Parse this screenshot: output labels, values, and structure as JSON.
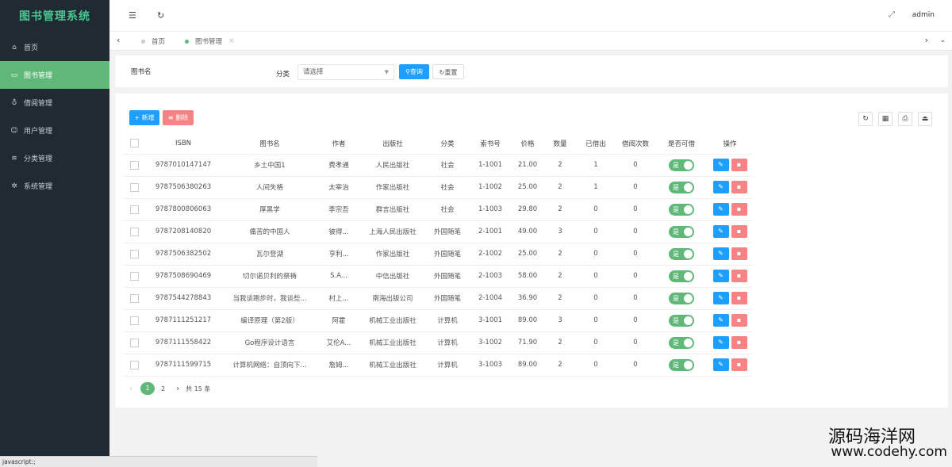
{
  "app": {
    "title": "图书管理系统"
  },
  "sidebar": {
    "items": [
      {
        "label": "首页",
        "icon": "home-icon"
      },
      {
        "label": "图书管理",
        "icon": "book-icon",
        "active": true
      },
      {
        "label": "借阅管理",
        "icon": "location-icon"
      },
      {
        "label": "用户管理",
        "icon": "user-icon"
      },
      {
        "label": "分类管理",
        "icon": "layers-icon"
      },
      {
        "label": "系统管理",
        "icon": "gear-icon"
      }
    ]
  },
  "topbar": {
    "user": "admin"
  },
  "tabs": [
    {
      "label": "首页",
      "active": false
    },
    {
      "label": "图书管理",
      "active": true
    }
  ],
  "search": {
    "name_value": "图书名",
    "category_label": "分类",
    "category_placeholder": "请选择",
    "query_label": "查询",
    "reset_label": "重置"
  },
  "toolbar": {
    "add_label": "新增",
    "delete_label": "删除"
  },
  "table": {
    "headers": [
      "ISBN",
      "图书名",
      "作者",
      "出版社",
      "分类",
      "索书号",
      "价格",
      "数量",
      "已借出",
      "借阅次数",
      "是否可借",
      "操作"
    ],
    "rows": [
      [
        "9787010147147",
        "乡土中国1",
        "费孝通",
        "人民出版社",
        "社会",
        "1-1001",
        "21.00",
        "2",
        "1",
        "0"
      ],
      [
        "9787506380263",
        "人间失格",
        "太宰治",
        "作家出版社",
        "社会",
        "1-1002",
        "25.00",
        "2",
        "1",
        "0"
      ],
      [
        "9787800806063",
        "厚黑学",
        "李宗吾",
        "群言出版社",
        "社会",
        "1-1003",
        "29.80",
        "2",
        "0",
        "0"
      ],
      [
        "9787208140820",
        "痛苦的中国人",
        "彼得...",
        "上海人民出版社",
        "外国随笔",
        "2-1001",
        "49.00",
        "3",
        "0",
        "0"
      ],
      [
        "9787506382502",
        "瓦尔登湖",
        "亨利...",
        "作家出版社",
        "外国随笔",
        "2-1002",
        "25.00",
        "2",
        "0",
        "0"
      ],
      [
        "9787508690469",
        "切尔诺贝利的祭祷",
        "S.A...",
        "中信出版社",
        "外国随笔",
        "2-1003",
        "58.00",
        "2",
        "0",
        "0"
      ],
      [
        "9787544278843",
        "当我谈跑步时，我谈些...",
        "村上...",
        "南海出版公司",
        "外国随笔",
        "2-1004",
        "36.90",
        "2",
        "0",
        "0"
      ],
      [
        "9787111251217",
        "编译原理（第2版）",
        "阿霍",
        "机械工业出版社",
        "计算机",
        "3-1001",
        "89.00",
        "3",
        "0",
        "0"
      ],
      [
        "9787111558422",
        "Go程序设计语言",
        "艾伦A...",
        "机械工业出版社",
        "计算机",
        "3-1002",
        "71.90",
        "2",
        "0",
        "0"
      ],
      [
        "9787111599715",
        "计算机网络：自顶向下...",
        "詹姆...",
        "机械工业出版社",
        "计算机",
        "3-1003",
        "89.00",
        "2",
        "0",
        "0"
      ]
    ],
    "switch_label": "是"
  },
  "pager": {
    "current": "1",
    "next_page": "2",
    "total": "共 15 条"
  },
  "status": {
    "text": "javascript:;"
  },
  "watermark": {
    "line1": "源码海洋网",
    "line2": "www.codehy.com"
  },
  "colors": {
    "sidebar_bg": "#1f2a33",
    "accent_green": "#5fb878",
    "primary_blue": "#1e9fff",
    "danger": "#f48484"
  }
}
